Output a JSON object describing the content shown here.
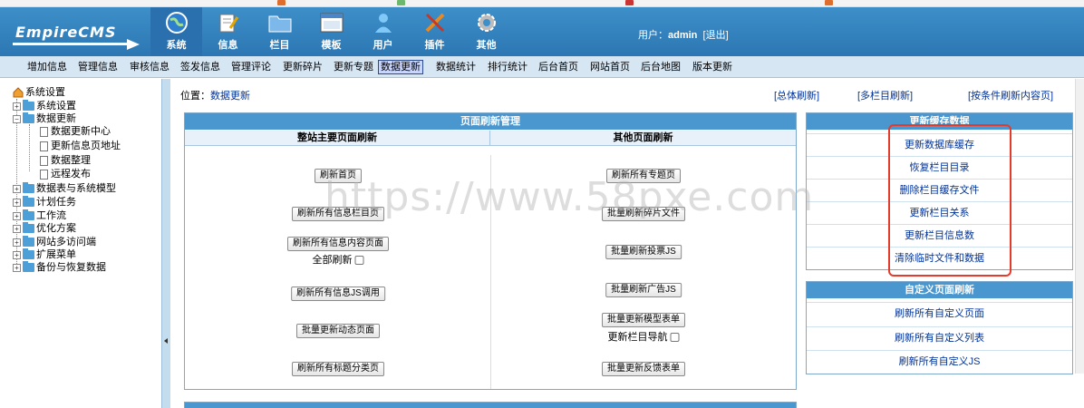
{
  "header": {
    "logo_text": "EmpireCMS",
    "nav": [
      {
        "label": "系统",
        "icon": "globe-icon",
        "active": true
      },
      {
        "label": "信息",
        "icon": "notepad-icon"
      },
      {
        "label": "栏目",
        "icon": "folder-icon"
      },
      {
        "label": "模板",
        "icon": "window-icon"
      },
      {
        "label": "用户",
        "icon": "user-icon"
      },
      {
        "label": "插件",
        "icon": "tools-icon"
      },
      {
        "label": "其他",
        "icon": "gear-icon"
      }
    ],
    "user_label": "用户：",
    "username": "admin",
    "logout": "[退出]"
  },
  "subnav": [
    {
      "label": "增加信息"
    },
    {
      "label": "管理信息"
    },
    {
      "label": "审核信息"
    },
    {
      "label": "签发信息"
    },
    {
      "label": "管理评论"
    },
    {
      "label": "更新碎片"
    },
    {
      "label": "更新专题"
    },
    {
      "label": "数据更新",
      "active": true
    },
    {
      "label": "数据统计"
    },
    {
      "label": "排行统计"
    },
    {
      "label": "后台首页"
    },
    {
      "label": "网站首页"
    },
    {
      "label": "后台地图"
    },
    {
      "label": "版本更新"
    }
  ],
  "tree": {
    "root": "系统设置",
    "items": [
      "系统设置",
      "数据更新",
      "数据更新中心",
      "更新信息页地址",
      "数据整理",
      "远程发布",
      "数据表与系统模型",
      "计划任务",
      "工作流",
      "优化方案",
      "网站多访问端",
      "扩展菜单",
      "备份与恢复数据"
    ]
  },
  "main": {
    "position_label": "位置：",
    "position_link": "数据更新",
    "links": [
      "[总体刷新]",
      "[多栏目刷新]",
      "[按条件刷新内容页]"
    ],
    "page_refresh": {
      "title": "页面刷新管理",
      "left_head": "整站主要页面刷新",
      "right_head": "其他页面刷新",
      "left_buttons": [
        "刷新首页",
        "刷新所有信息栏目页",
        "刷新所有信息内容页面",
        "刷新所有信息JS调用",
        "批量更新动态页面",
        "刷新所有标题分类页"
      ],
      "full_refresh_label": "全部刷新",
      "right_buttons": [
        "刷新所有专题页",
        "批量刷新碎片文件",
        "批量刷新投票JS",
        "批量刷新广告JS",
        "批量更新模型表单",
        "批量更新反馈表单"
      ],
      "column_nav_label": "更新栏目导航"
    },
    "cache_panel": {
      "title": "更新缓存数据",
      "items": [
        "更新数据库缓存",
        "恢复栏目目录",
        "删除栏目缓存文件",
        "更新栏目关系",
        "更新栏目信息数",
        "清除临时文件和数据"
      ]
    },
    "custom_panel": {
      "title": "自定义页面刷新",
      "items": [
        "刷新所有自定义页面",
        "刷新所有自定义列表",
        "刷新所有自定义JS"
      ]
    }
  },
  "watermark": "https://www.58pxe.com",
  "colors": {
    "header": "#3d8fc9",
    "panel_head": "#4a96cf",
    "highlight_box": "#e53b2c",
    "link": "#00339a"
  }
}
